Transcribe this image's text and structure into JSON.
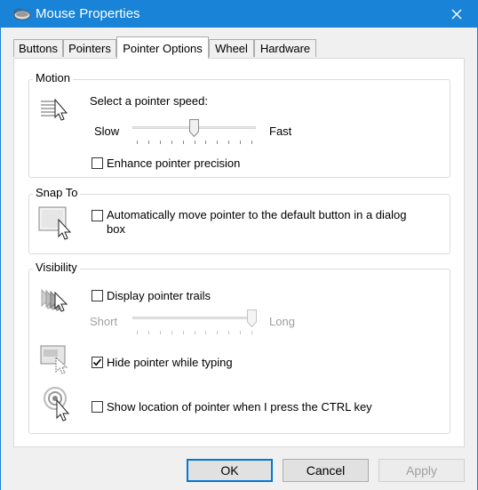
{
  "window": {
    "title": "Mouse Properties",
    "close_symbol": "✕"
  },
  "tabs": [
    {
      "label": "Buttons"
    },
    {
      "label": "Pointers"
    },
    {
      "label": "Pointer Options"
    },
    {
      "label": "Wheel"
    },
    {
      "label": "Hardware"
    }
  ],
  "motion": {
    "group_label": "Motion",
    "speed_prompt": "Select a pointer speed:",
    "slow_label": "Slow",
    "fast_label": "Fast",
    "speed_fraction": 0.5,
    "precision_label": "Enhance pointer precision",
    "precision_checked": false
  },
  "snap": {
    "group_label": "Snap To",
    "auto_move_label_line1": "Automatically move pointer to the default button in a dialog",
    "auto_move_label_line2": "box",
    "auto_move_checked": false
  },
  "visibility": {
    "group_label": "Visibility",
    "trails_label": "Display pointer trails",
    "trails_checked": false,
    "short_label": "Short",
    "long_label": "Long",
    "trail_length_fraction": 1.0,
    "hide_label": "Hide pointer while typing",
    "hide_checked": true,
    "ctrl_label": "Show location of pointer when I press the CTRL key",
    "ctrl_checked": false
  },
  "buttons": {
    "ok": "OK",
    "cancel": "Cancel",
    "apply": "Apply"
  }
}
